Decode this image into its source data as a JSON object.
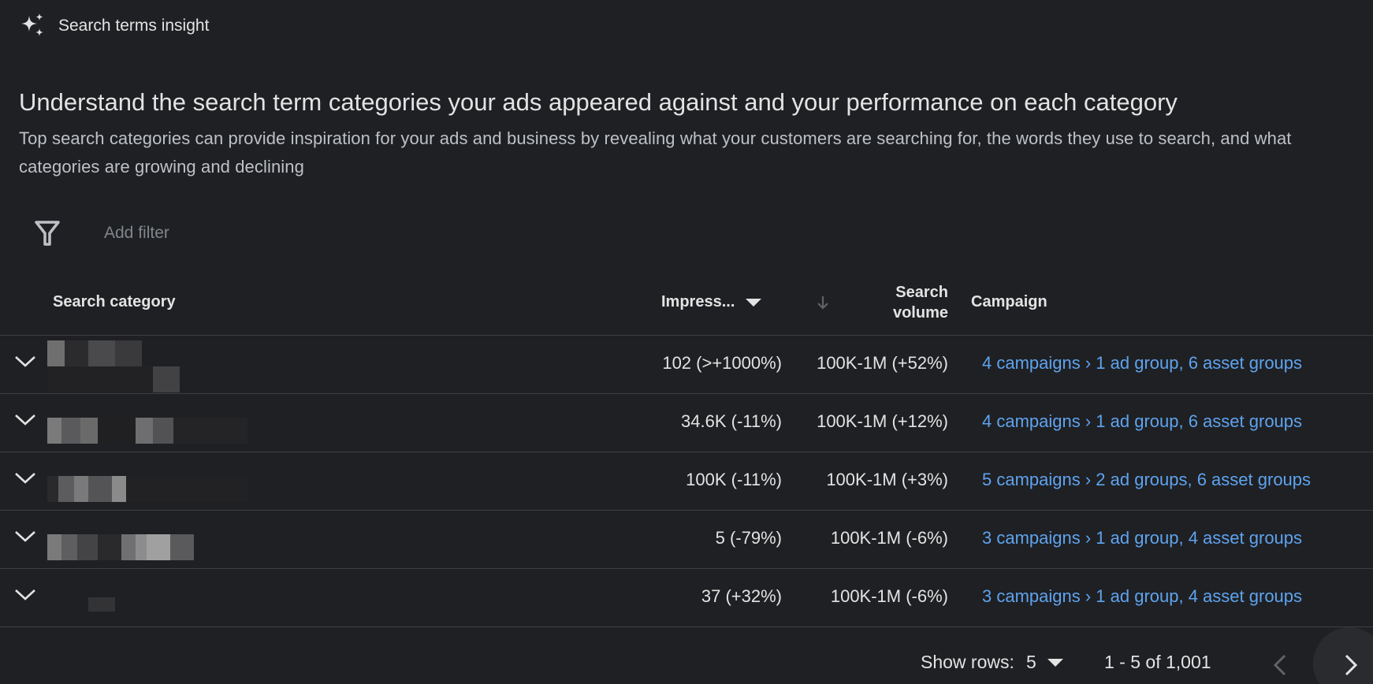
{
  "header": {
    "title": "Search terms insight"
  },
  "intro": {
    "headline": "Understand the search term categories your ads appeared against and your performance on each category",
    "description": "Top search categories can provide inspiration for your ads and business by revealing what your customers are searching for, the words they use to search, and what categories are growing and declining"
  },
  "filter": {
    "placeholder": "Add filter"
  },
  "table": {
    "columns": {
      "category": "Search category",
      "impressions": "Impress...",
      "volume_line1": "Search",
      "volume_line2": "volume",
      "campaign": "Campaign"
    },
    "rows": [
      {
        "impressions": "102 (>+1000%)",
        "volume": "100K-1M (+52%)",
        "campaign": "4 campaigns › 1 ad group, 6 asset groups"
      },
      {
        "impressions": "34.6K (-11%)",
        "volume": "100K-1M (+12%)",
        "campaign": "4 campaigns › 1 ad group, 6 asset groups"
      },
      {
        "impressions": "100K (-11%)",
        "volume": "100K-1M (+3%)",
        "campaign": "5 campaigns › 2 ad groups, 6 asset groups"
      },
      {
        "impressions": "5 (-79%)",
        "volume": "100K-1M (-6%)",
        "campaign": "3 campaigns › 1 ad group, 4 asset groups"
      },
      {
        "impressions": "37 (+32%)",
        "volume": "100K-1M (-6%)",
        "campaign": "3 campaigns › 1 ad group, 4 asset groups"
      }
    ]
  },
  "pagination": {
    "show_rows_label": "Show rows:",
    "rows_value": "5",
    "range": "1 - 5 of 1,001"
  },
  "colors": {
    "background": "#1f2023",
    "link": "#5ea3ef",
    "divider": "#3c4043"
  },
  "icons": {
    "header": "sparkle-icon",
    "filter": "filter-funnel-icon",
    "sort": "arrow-down-icon",
    "expand": "chevron-down-icon",
    "prev": "chevron-left-icon",
    "next": "chevron-right-icon"
  }
}
